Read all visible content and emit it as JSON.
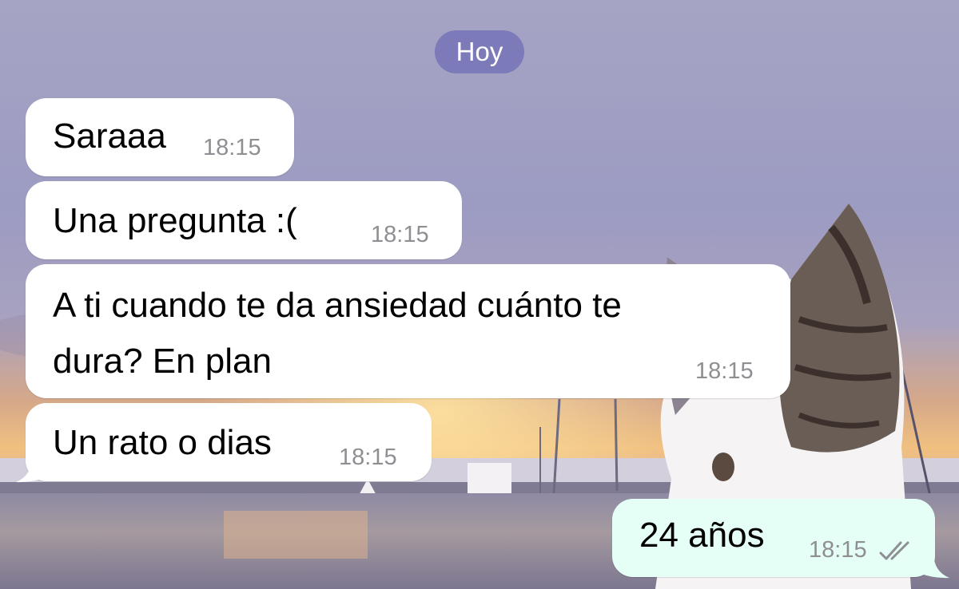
{
  "chat": {
    "date_separator": "Hoy",
    "messages": [
      {
        "text": "Saraaa",
        "time": "18:15"
      },
      {
        "text": "Una pregunta :(",
        "time": "18:15"
      },
      {
        "line1": "A ti cuando te da ansiedad cuánto te",
        "line2": "dura? En plan",
        "time": "18:15"
      },
      {
        "text": "Un rato o dias",
        "time": "18:15"
      },
      {
        "text": "24 años",
        "time": "18:15",
        "status": "read"
      }
    ]
  },
  "colors": {
    "incoming_bubble": "#ffffff",
    "outgoing_bubble": "#e5fef6",
    "date_pill": "#7a76b8",
    "timestamp": "#8e8e93"
  },
  "icons": {
    "read_receipt": "double-check-icon"
  }
}
